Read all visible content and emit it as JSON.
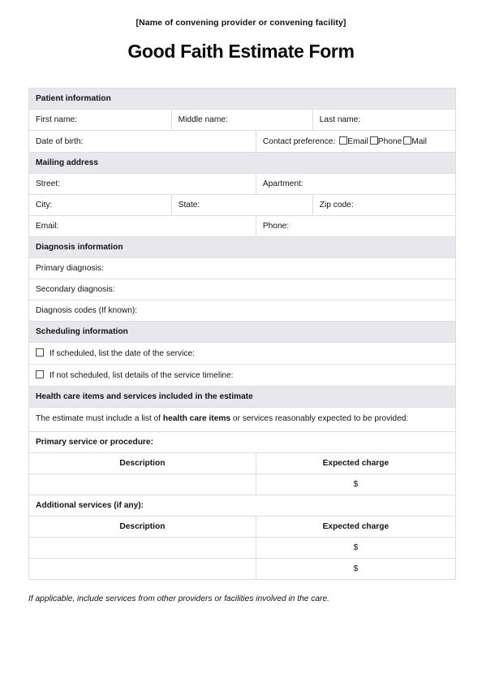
{
  "header": {
    "provider_placeholder": "[Name of convening provider or convening facility]",
    "title": "Good Faith Estimate Form"
  },
  "sections": {
    "patient_information": {
      "heading": "Patient information",
      "first_name_label": "First name:",
      "middle_name_label": "Middle name:",
      "last_name_label": "Last name:",
      "date_of_birth_label": "Date of birth:",
      "contact_preference_label": "Contact preference:",
      "contact_options": [
        "Email",
        "Phone",
        "Mail"
      ]
    },
    "mailing_address": {
      "heading": "Mailing address",
      "street_label": "Street:",
      "apartment_label": "Apartment:",
      "city_label": "City:",
      "state_label": "State:",
      "zip_label": "Zip code:",
      "email_label": "Email:",
      "phone_label": "Phone:"
    },
    "diagnosis_information": {
      "heading": "Diagnosis information",
      "primary_label": "Primary diagnosis:",
      "secondary_label": "Secondary diagnosis:",
      "codes_label": "Diagnosis codes (If known):"
    },
    "scheduling_information": {
      "heading": "Scheduling information",
      "scheduled_label": "If scheduled, list the date of the service:",
      "not_scheduled_label": "If not scheduled, list details of the service timeline:"
    },
    "health_care_items": {
      "heading": "Health care items and services included in the estimate",
      "paragraph_before": "The estimate must include a list of ",
      "paragraph_bold": "health care items",
      "paragraph_after": " or services reasonably expected to be provided:",
      "primary_service_label": "Primary service or procedure:",
      "additional_services_label": "Additional services (if any):",
      "columns": {
        "description": "Description",
        "expected_charge": "Expected charge"
      },
      "currency_symbol": "$",
      "primary_rows": [
        {
          "description": "",
          "expected_charge": "$"
        }
      ],
      "additional_rows": [
        {
          "description": "",
          "expected_charge": "$"
        },
        {
          "description": "",
          "expected_charge": "$"
        }
      ]
    }
  },
  "footer": {
    "note": "If applicable, include services from other providers or facilities involved in the care."
  },
  "colors": {
    "section_header_bg": "#e7e7ec",
    "border": "#dcdce2",
    "text": "#111111",
    "page_bg": "#ffffff"
  }
}
